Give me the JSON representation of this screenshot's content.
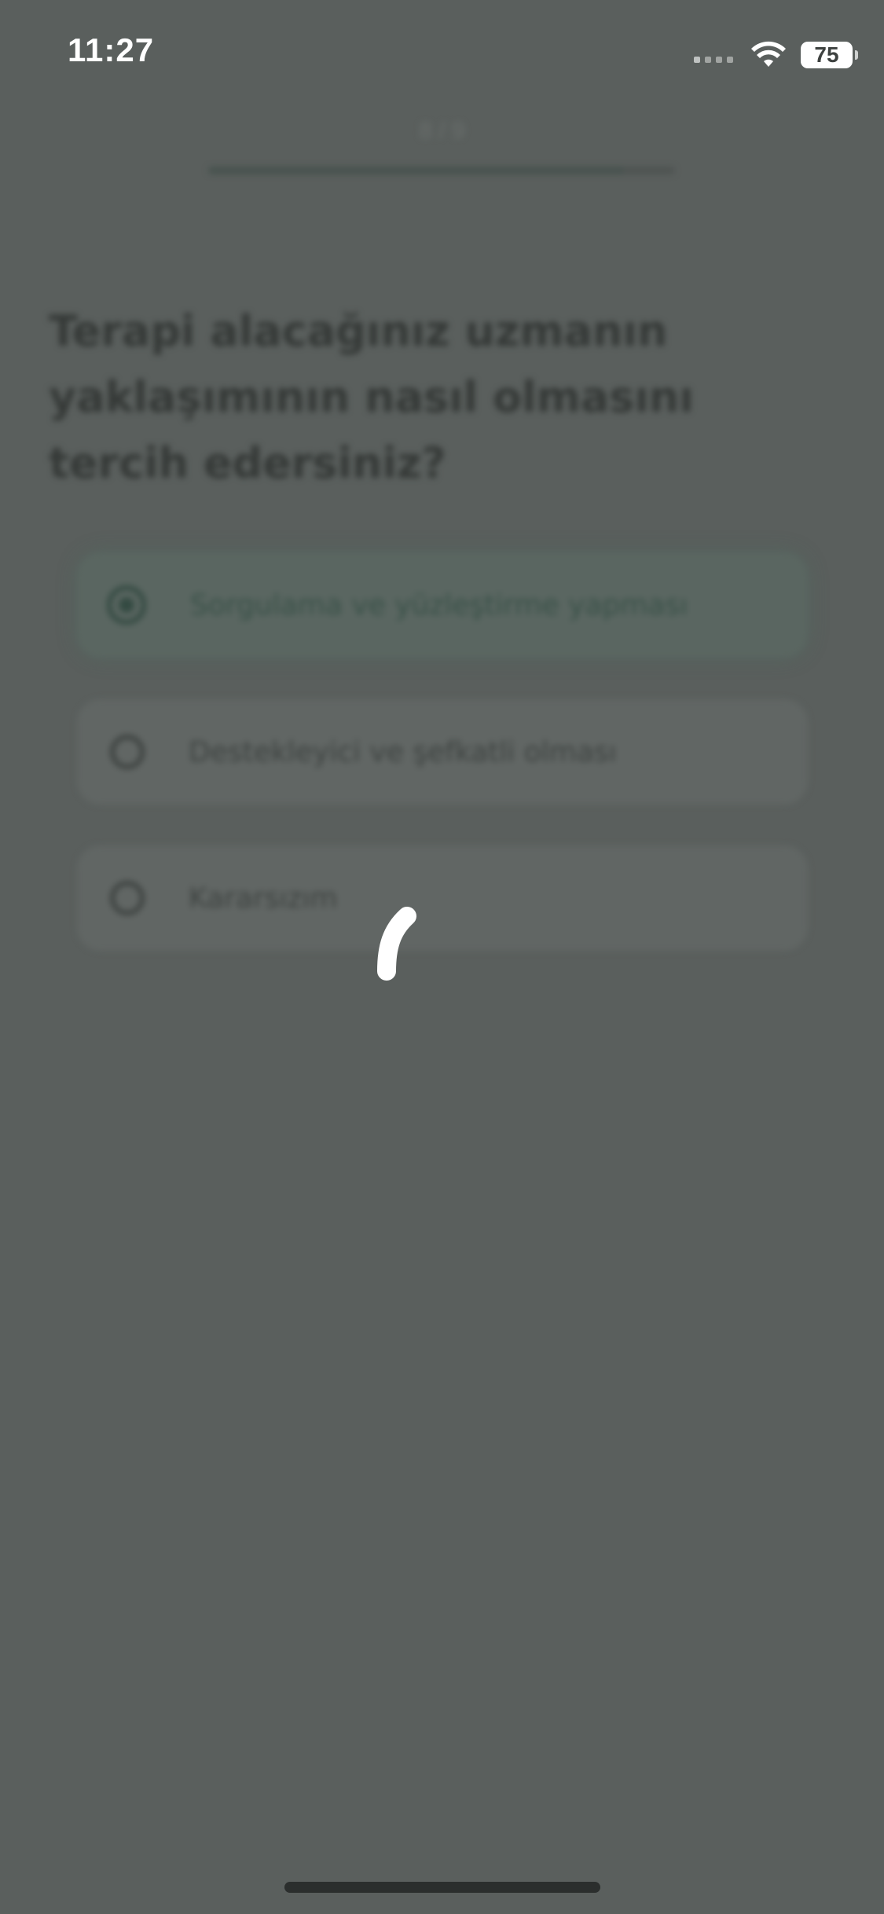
{
  "status_bar": {
    "time": "11:27",
    "battery": "75",
    "icons": [
      "cellular-signal-icon",
      "wifi-icon",
      "battery-icon"
    ]
  },
  "header": {
    "step_current": "8",
    "step_separator": "/",
    "step_total": "9",
    "progress_fraction": 0.89
  },
  "question": {
    "text": "Terapi alacağınız uzmanın yaklaşımının nasıl olmasını tercih edersiniz?"
  },
  "options": [
    {
      "label": "Sorgulama ve yüzleştirme yapması",
      "selected": true
    },
    {
      "label": "Destekleyici ve şefkatli olması",
      "selected": false
    },
    {
      "label": "Kararsızım",
      "selected": false
    }
  ],
  "loading": {
    "icon": "loading-spinner-icon",
    "color": "#ffffff"
  },
  "colors": {
    "overlay_background": "#5a5f5d",
    "selected_accent": "#344a42"
  }
}
